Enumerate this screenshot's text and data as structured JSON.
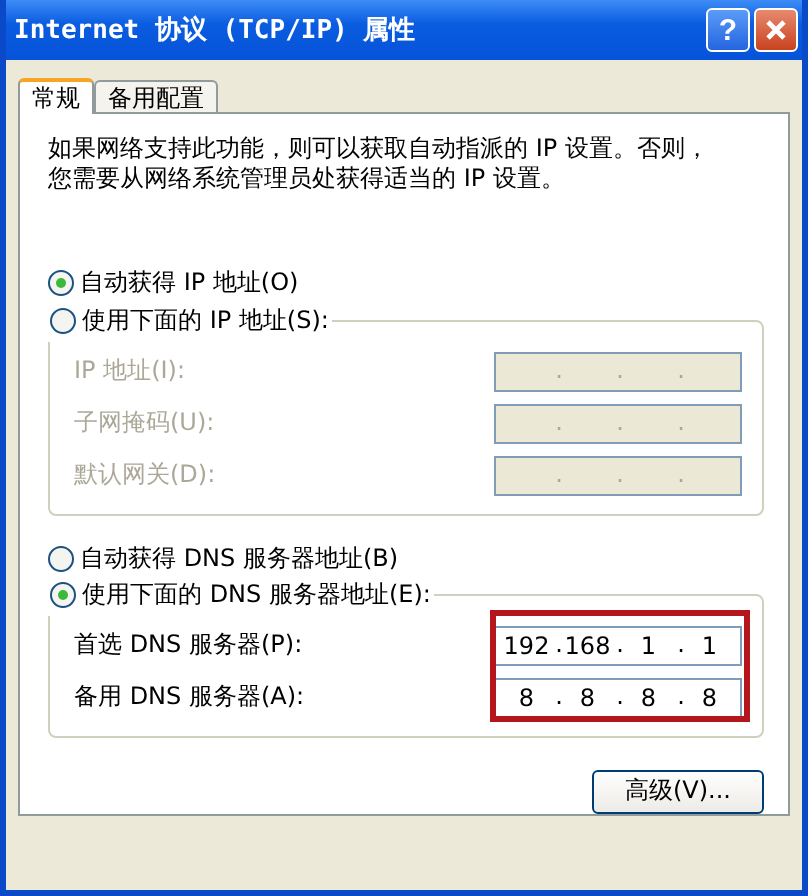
{
  "window": {
    "title": "Internet 协议 (TCP/IP) 属性",
    "help_label": "?"
  },
  "tabs": [
    {
      "label": "常规",
      "selected": true
    },
    {
      "label": "备用配置",
      "selected": false
    }
  ],
  "description": [
    "如果网络支持此功能，则可以获取自动指派的 IP 设置。否则，",
    "您需要从网络系统管理员处获得适当的 IP 设置。"
  ],
  "address_separator": ".",
  "ip_mode": [
    {
      "label": "自动获得 IP 地址(O)",
      "selected": true
    },
    {
      "label": "使用下面的 IP 地址(S):",
      "selected": false
    }
  ],
  "ip_fields": [
    {
      "label": "IP 地址(I):",
      "disabled": true
    },
    {
      "label": "子网掩码(U):",
      "disabled": true
    },
    {
      "label": "默认网关(D):",
      "disabled": true
    }
  ],
  "dns_mode": [
    {
      "label": "自动获得 DNS 服务器地址(B)",
      "selected": false
    },
    {
      "label": "使用下面的 DNS 服务器地址(E):",
      "selected": true
    }
  ],
  "dns_fields": [
    {
      "label": "首选 DNS 服务器(P):",
      "disabled": false,
      "octets": [
        "192",
        "168",
        "1",
        "1"
      ]
    },
    {
      "label": "备用 DNS 服务器(A):",
      "disabled": false,
      "octets": [
        "8",
        "8",
        "8",
        "8"
      ]
    }
  ],
  "dns_highlighted": true,
  "advanced_button": "高级(V)..."
}
